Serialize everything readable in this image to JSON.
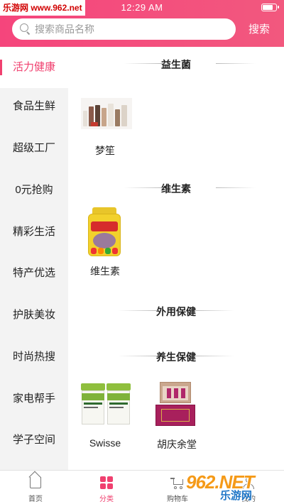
{
  "status_bar": {
    "watermark_text": "乐游网 www.962.net",
    "time": "12:29 AM"
  },
  "search": {
    "placeholder": "搜索商品名称",
    "button_label": "搜索"
  },
  "sidebar": {
    "items": [
      {
        "label": "活力健康",
        "active": true
      },
      {
        "label": "食品生鲜"
      },
      {
        "label": "超级工厂"
      },
      {
        "label": "0元抢购"
      },
      {
        "label": "精彩生活"
      },
      {
        "label": "特产优选"
      },
      {
        "label": "护肤美妆"
      },
      {
        "label": "时尚热搜"
      },
      {
        "label": "家电帮手"
      },
      {
        "label": "学子空间"
      }
    ]
  },
  "sections": [
    {
      "title": "益生菌",
      "products": [
        {
          "name": "梦笙"
        }
      ]
    },
    {
      "title": "维生素",
      "products": [
        {
          "name": "维生素"
        }
      ]
    },
    {
      "title": "外用保健",
      "products": []
    },
    {
      "title": "养生保健",
      "products": [
        {
          "name": "Swisse"
        },
        {
          "name": "胡庆余堂"
        }
      ]
    }
  ],
  "tabbar": {
    "items": [
      {
        "label": "首页",
        "icon": "home-icon"
      },
      {
        "label": "分类",
        "icon": "category-icon",
        "active": true
      },
      {
        "label": "购物车",
        "icon": "cart-icon"
      },
      {
        "label": "我的",
        "icon": "user-icon"
      }
    ]
  },
  "watermark": {
    "big": "962.NET",
    "small": "乐游网"
  },
  "colors": {
    "accent": "#f0406f",
    "header": "#f5457c"
  }
}
